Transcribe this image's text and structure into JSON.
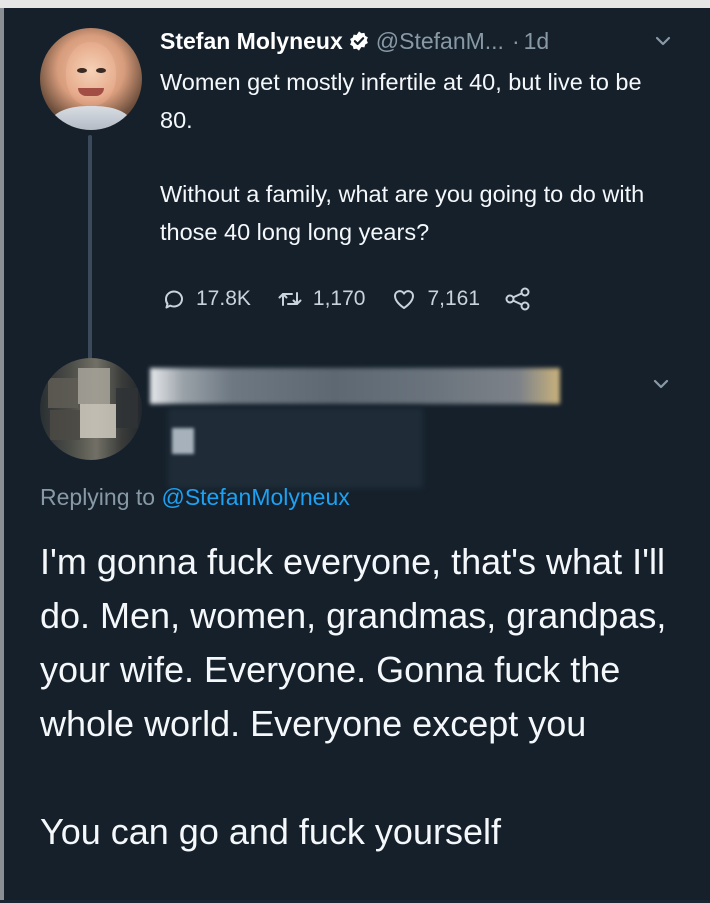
{
  "original_tweet": {
    "author_name": "Stefan Molyneux",
    "handle": "@StefanM...",
    "separator": "·",
    "timestamp": "1d",
    "text_paragraphs": [
      "Women get mostly infertile at 40, but live to be 80.",
      "Without a family, what are you going to do with those 40 long long years?"
    ],
    "stats": {
      "replies": "17.8K",
      "retweets": "1,170",
      "likes": "7,161"
    }
  },
  "reply_tweet": {
    "replying_to_prefix": "Replying to",
    "replying_to_mention": "@StefanMolyneux",
    "text_paragraphs": [
      "I'm gonna fuck everyone, that's what I'll do. Men, women, grandmas, grandpas, your wife. Everyone. Gonna fuck the whole world. Everyone except you",
      "You can go and fuck yourself"
    ]
  },
  "colors": {
    "background": "#15202b",
    "text_primary": "#f5f8fa",
    "text_secondary": "#8899a6",
    "link": "#1da1f2",
    "verified_badge": "#ffffff"
  },
  "icons": {
    "verified": "verified-badge-icon",
    "caret": "chevron-down-icon",
    "reply": "reply-bubble-icon",
    "retweet": "retweet-icon",
    "like": "heart-icon",
    "share": "share-icon"
  }
}
